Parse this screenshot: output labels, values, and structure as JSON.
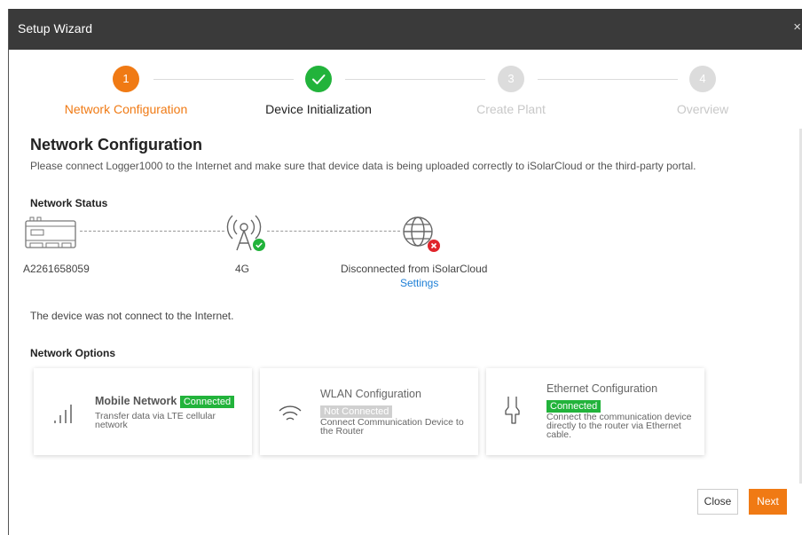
{
  "header": {
    "title": "Setup Wizard",
    "close_glyph": "×"
  },
  "steps": [
    {
      "number": "1",
      "label": "Network Configuration",
      "state": "active"
    },
    {
      "number": "",
      "label": "Device Initialization",
      "state": "done"
    },
    {
      "number": "3",
      "label": "Create Plant",
      "state": "todo"
    },
    {
      "number": "4",
      "label": "Overview",
      "state": "todo"
    }
  ],
  "main": {
    "title": "Network Configuration",
    "description": "Please connect Logger1000 to the Internet and make sure that device data is being uploaded correctly to iSolarCloud or the third-party portal."
  },
  "network_status": {
    "heading": "Network Status",
    "device_serial": "A2261658059",
    "link_type": "4G",
    "cloud_status": "Disconnected from iSolarCloud",
    "settings_link": "Settings",
    "message": "The device was not connect to the Internet."
  },
  "network_options": {
    "heading": "Network Options",
    "cards": [
      {
        "title": "Mobile Network",
        "status": "Connected",
        "description": "Transfer data via LTE cellular network",
        "icon": "signal-bars-icon"
      },
      {
        "title": "WLAN Configuration",
        "status": "Not Connected",
        "description": "Connect Communication Device to the Router",
        "icon": "wifi-icon"
      },
      {
        "title": "Ethernet Configuration",
        "status": "Connected",
        "description": "Connect the communication device directly to the router via Ethernet cable.",
        "icon": "ethernet-plug-icon"
      }
    ]
  },
  "footer": {
    "close_label": "Close",
    "next_label": "Next"
  },
  "colors": {
    "accent": "#f07a14",
    "success": "#22b33b",
    "error": "#e0242b",
    "link": "#1e7fd6",
    "header_bg": "#3a3a3a"
  }
}
